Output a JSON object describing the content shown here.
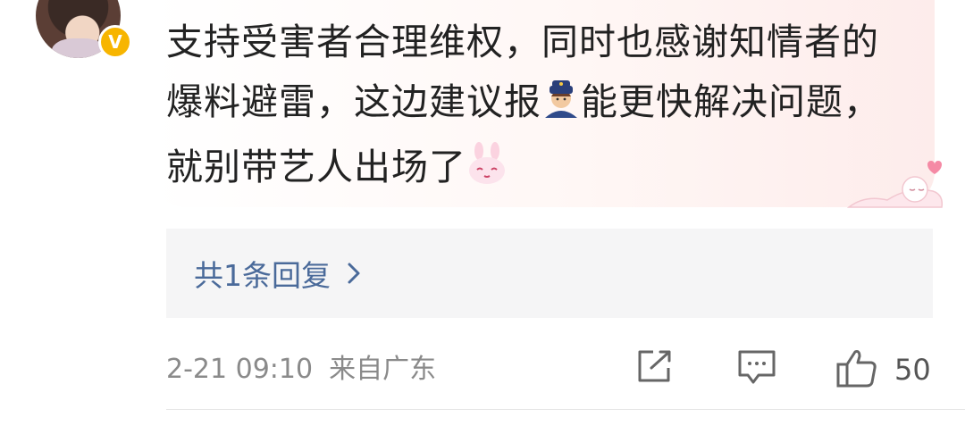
{
  "comment": {
    "text_part1": "支持受害者合理维权，同时也感谢知情者的爆料避雷，这边建议报",
    "emoji_police": "police-officer-emoji",
    "text_part2": "能更快解决问题，就别带艺人出场了",
    "emoji_bunny": "bunny-smile-emoji"
  },
  "user": {
    "badge": "V"
  },
  "replies": {
    "label": "共1条回复"
  },
  "meta": {
    "time": "2-21 09:10",
    "location": "来自广东"
  },
  "actions": {
    "likes": "50"
  },
  "colors": {
    "link": "#4a6a9a",
    "badge": "#f7b500",
    "text": "#222222",
    "meta": "#8a8a8a"
  }
}
